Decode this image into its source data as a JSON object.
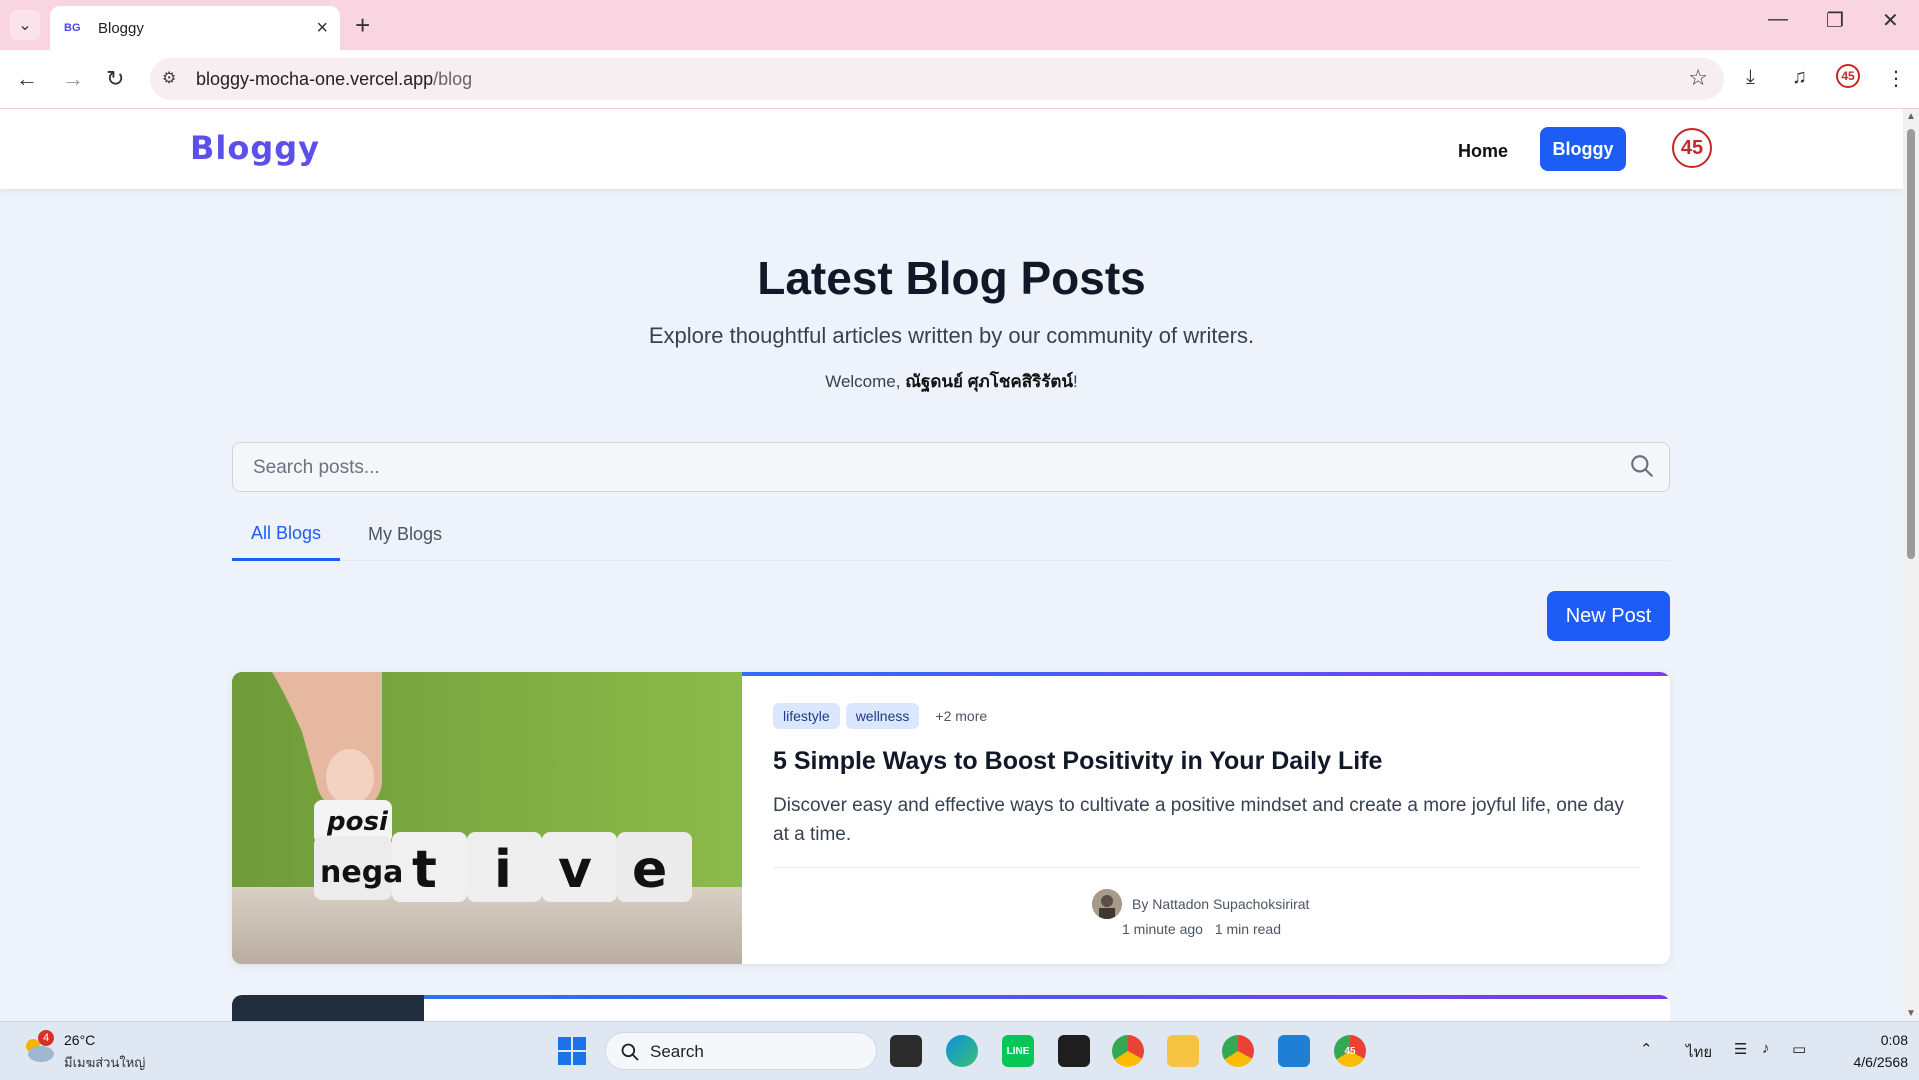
{
  "browser": {
    "tab_favicon": "BG",
    "tab_title": "Bloggy",
    "new_tab": "+",
    "url_host": "bloggy-mocha-one.vercel.app",
    "url_path": "/blog",
    "extension_badge": "45"
  },
  "site": {
    "logo": "Bloggy",
    "nav_home": "Home",
    "nav_bloggy": "Bloggy",
    "user_avatar": "45"
  },
  "hero": {
    "title": "Latest Blog Posts",
    "subtitle": "Explore thoughtful articles written by our community of writers.",
    "welcome_prefix": "Welcome, ",
    "welcome_name": "ณัฐดนย์ ศุภโชคสิริรัตน์",
    "welcome_suffix": "!"
  },
  "search": {
    "placeholder": "Search posts..."
  },
  "tabs": {
    "all": "All Blogs",
    "mine": "My Blogs"
  },
  "new_post": "New Post",
  "posts": [
    {
      "tags": [
        "lifestyle",
        "wellness"
      ],
      "more_tags": "+2 more",
      "title": "5 Simple Ways to Boost Positivity in Your Daily Life",
      "excerpt": "Discover easy and effective ways to cultivate a positive mindset and create a more joyful life, one day at a time.",
      "author": "By Nattadon Supachoksirirat",
      "time_ago": "1 minute ago",
      "read_time": "1 min read",
      "image_dice": [
        "nega",
        "t",
        "i",
        "v",
        "e"
      ],
      "image_top_dice": "posi"
    }
  ],
  "taskbar": {
    "weather_badge": "4",
    "weather_temp": "26°C",
    "weather_desc": "มีเมฆส่วนใหญ่",
    "search_label": "Search",
    "lang": "ไทย",
    "time": "0:08",
    "date": "4/6/2568",
    "chrome_badge": "45"
  }
}
